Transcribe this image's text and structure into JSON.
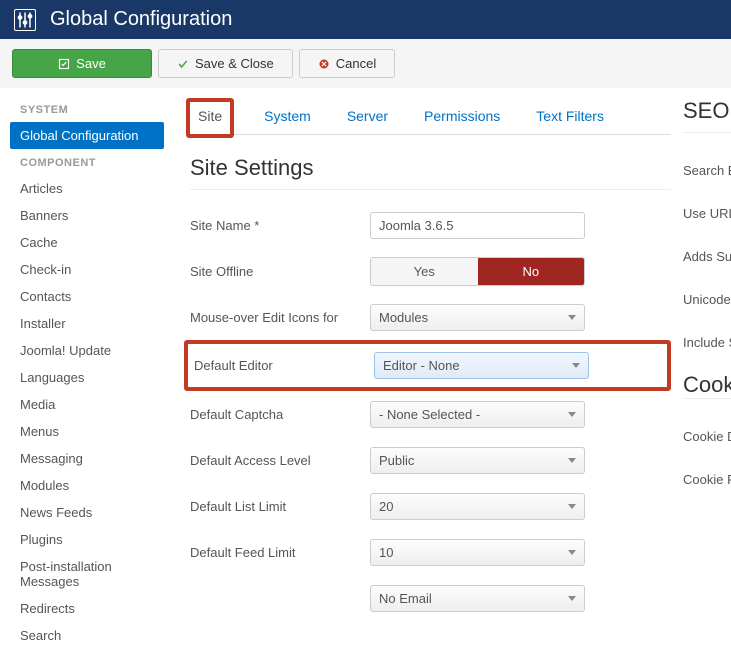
{
  "header": {
    "title": "Global Configuration"
  },
  "toolbar": {
    "save": "Save",
    "saveClose": "Save & Close",
    "cancel": "Cancel"
  },
  "sidebar": {
    "systemHeading": "SYSTEM",
    "systemItems": [
      "Global Configuration"
    ],
    "componentHeading": "COMPONENT",
    "componentItems": [
      "Articles",
      "Banners",
      "Cache",
      "Check-in",
      "Contacts",
      "Installer",
      "Joomla! Update",
      "Languages",
      "Media",
      "Menus",
      "Messaging",
      "Modules",
      "News Feeds",
      "Plugins",
      "Post-installation Messages",
      "Redirects",
      "Search"
    ]
  },
  "tabs": [
    "Site",
    "System",
    "Server",
    "Permissions",
    "Text Filters"
  ],
  "section": {
    "title": "Site Settings"
  },
  "form": {
    "siteName": {
      "label": "Site Name *",
      "value": "Joomla 3.6.5"
    },
    "siteOffline": {
      "label": "Site Offline",
      "yes": "Yes",
      "no": "No",
      "selected": "No"
    },
    "mouseOver": {
      "label": "Mouse-over Edit Icons for",
      "value": "Modules"
    },
    "defaultEditor": {
      "label": "Default Editor",
      "value": "Editor - None"
    },
    "defaultCaptcha": {
      "label": "Default Captcha",
      "value": "- None Selected -"
    },
    "defaultAccess": {
      "label": "Default Access Level",
      "value": "Public"
    },
    "defaultListLimit": {
      "label": "Default List Limit",
      "value": "20"
    },
    "defaultFeedLimit": {
      "label": "Default Feed Limit",
      "value": "10"
    },
    "feedEmail": {
      "label": "",
      "value": "No Email"
    }
  },
  "right": {
    "seoTitle": "SEO Settings",
    "items": [
      "Search Engine",
      "Use URL Rewriting",
      "Adds Suffix",
      "Unicode Aliases",
      "Include Site"
    ],
    "cookieTitle": "Cookie Settings",
    "cookieItems": [
      "Cookie Domain",
      "Cookie Path"
    ]
  }
}
